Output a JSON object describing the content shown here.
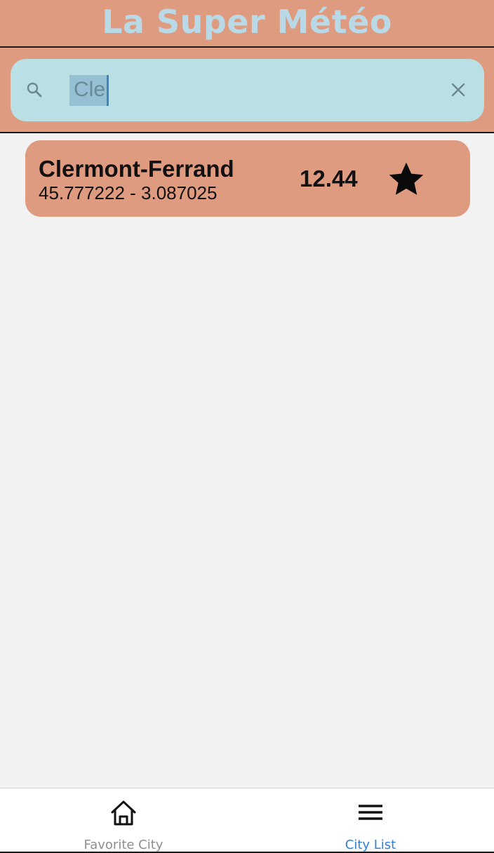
{
  "header": {
    "title": "La Super Météo"
  },
  "search": {
    "value": "Cle",
    "search_icon": "search-icon",
    "clear_icon": "close-icon"
  },
  "cities": [
    {
      "name": "Clermont-Ferrand",
      "coords": "45.777222 - 3.087025",
      "temperature": "12.44",
      "favorite": true,
      "favorite_icon": "star-icon"
    }
  ],
  "tabs": [
    {
      "label": "Favorite City",
      "icon": "home-icon",
      "active": false
    },
    {
      "label": "City List",
      "icon": "menu-icon",
      "active": true
    }
  ],
  "colors": {
    "header_bg": "#df9b80",
    "title_text": "#b9d9e6",
    "search_bg": "#badfe5",
    "card_bg": "#df9b80",
    "active_tab": "#2f7fd6",
    "inactive_tab": "#8e8e8e"
  }
}
